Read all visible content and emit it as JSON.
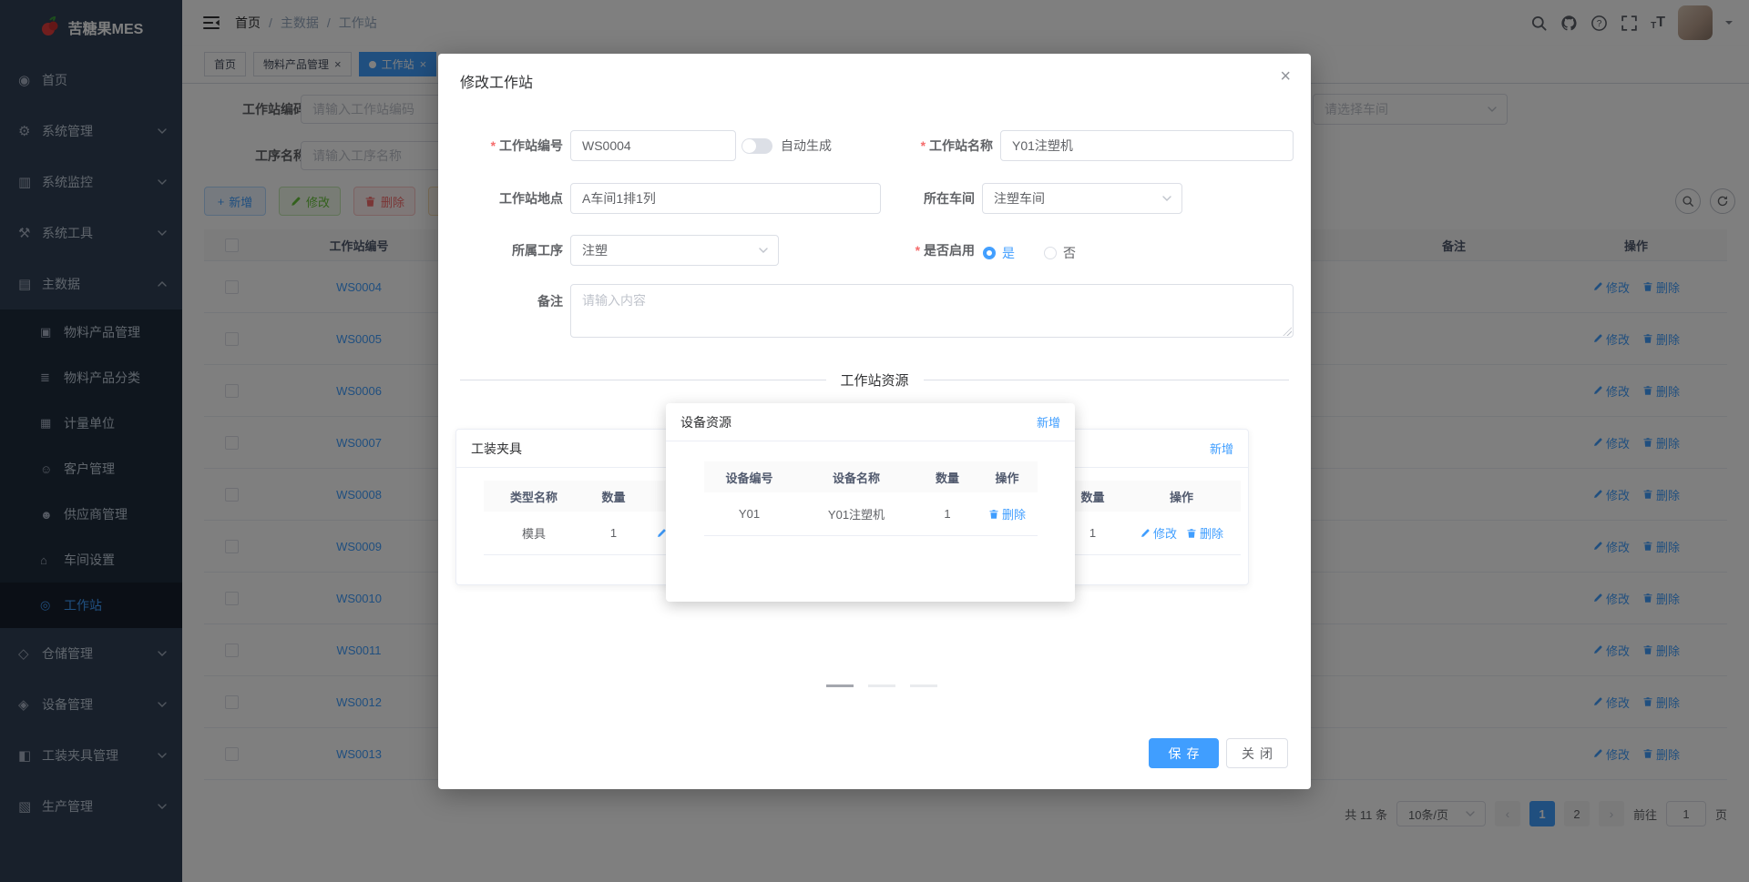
{
  "app": {
    "name": "苦糖果MES"
  },
  "icons": {
    "close": "×",
    "plus": "+",
    "breadcrumb_sep": "/"
  },
  "sidebar": {
    "menu": [
      {
        "id": "home",
        "label": "首页",
        "icon": "◉",
        "icon_name": "dashboard-icon",
        "type": "top"
      },
      {
        "id": "system-mgmt",
        "label": "系统管理",
        "icon": "⚙",
        "icon_name": "gear-icon",
        "type": "top",
        "chevron": "down"
      },
      {
        "id": "system-monitor",
        "label": "系统监控",
        "icon": "▥",
        "icon_name": "monitor-icon",
        "type": "top",
        "chevron": "down"
      },
      {
        "id": "system-tools",
        "label": "系统工具",
        "icon": "⚒",
        "icon_name": "toolbox-icon",
        "type": "top",
        "chevron": "down"
      },
      {
        "id": "master-data",
        "label": "主数据",
        "icon": "▤",
        "icon_name": "database-icon",
        "type": "top",
        "chevron": "up"
      },
      {
        "id": "material-product-mgmt",
        "label": "物料产品管理",
        "icon": "▣",
        "icon_name": "product-icon",
        "type": "sub"
      },
      {
        "id": "material-product-category",
        "label": "物料产品分类",
        "icon": "≣",
        "icon_name": "category-icon",
        "type": "sub"
      },
      {
        "id": "measure-unit",
        "label": "计量单位",
        "icon": "▦",
        "icon_name": "unit-icon",
        "type": "sub"
      },
      {
        "id": "customer-mgmt",
        "label": "客户管理",
        "icon": "☺",
        "icon_name": "customer-icon",
        "type": "sub"
      },
      {
        "id": "supplier-mgmt",
        "label": "供应商管理",
        "icon": "☻",
        "icon_name": "supplier-icon",
        "type": "sub"
      },
      {
        "id": "workshop-settings",
        "label": "车间设置",
        "icon": "⌂",
        "icon_name": "workshop-icon",
        "type": "sub"
      },
      {
        "id": "workstation",
        "label": "工作站",
        "icon": "◎",
        "icon_name": "workstation-icon",
        "type": "sub",
        "active": true
      },
      {
        "id": "warehouse-mgmt",
        "label": "仓储管理",
        "icon": "◇",
        "icon_name": "warehouse-icon",
        "type": "top",
        "chevron": "down"
      },
      {
        "id": "equipment-mgmt",
        "label": "设备管理",
        "icon": "◈",
        "icon_name": "equipment-icon",
        "type": "top",
        "chevron": "down"
      },
      {
        "id": "fixture-mgmt",
        "label": "工装夹具管理",
        "icon": "◧",
        "icon_name": "fixture-icon",
        "type": "top",
        "chevron": "down"
      },
      {
        "id": "production-mgmt",
        "label": "生产管理",
        "icon": "▧",
        "icon_name": "production-icon",
        "type": "top",
        "chevron": "down"
      }
    ]
  },
  "header": {
    "breadcrumb": [
      "首页",
      "主数据",
      "工作站"
    ]
  },
  "tags": [
    {
      "id": "home",
      "label": "首页"
    },
    {
      "id": "material-product-mgmt",
      "label": "物料产品管理",
      "closable": true
    },
    {
      "id": "workstation",
      "label": "工作站",
      "closable": true,
      "active": true
    }
  ],
  "filters": {
    "code_label": "工作站编码",
    "code_placeholder": "请输入工作站编码",
    "process_label": "工序名称",
    "process_placeholder": "请输入工序名称",
    "workshop_placeholder": "请选择车间"
  },
  "toolbar": {
    "add_label": "新增",
    "edit_label": "修改",
    "delete_label": "删除"
  },
  "table": {
    "header_code": "工作站编号",
    "header_remark": "备注",
    "header_op": "操作",
    "action_edit": "修改",
    "action_delete": "删除",
    "rows": [
      "WS0004",
      "WS0005",
      "WS0006",
      "WS0007",
      "WS0008",
      "WS0009",
      "WS0010",
      "WS0011",
      "WS0012",
      "WS0013"
    ]
  },
  "pagination": {
    "total": "共 11 条",
    "page_size": "10条/页",
    "prev": "‹",
    "next": "›",
    "pages": [
      {
        "label": "1",
        "active": true
      },
      {
        "label": "2"
      }
    ],
    "goto_label": "前往",
    "goto_value": "1",
    "page_unit": "页"
  },
  "modal": {
    "title": "修改工作站",
    "fields": {
      "code": {
        "label": "工作站编号",
        "value": "WS0004",
        "required": true
      },
      "auto_gen": {
        "label": "自动生成",
        "on": false
      },
      "name": {
        "label": "工作站名称",
        "value": "Y01注塑机",
        "required": true
      },
      "location": {
        "label": "工作站地点",
        "value": "A车间1排1列"
      },
      "workshop": {
        "label": "所在车间",
        "value": "注塑车间"
      },
      "process": {
        "label": "所属工序",
        "value": "注塑"
      },
      "enabled": {
        "label": "是否启用",
        "yes": "是",
        "no": "否",
        "selected": "yes",
        "required": true
      },
      "remark": {
        "label": "备注",
        "placeholder": "请输入内容",
        "value": ""
      }
    },
    "section_title": "工作站资源",
    "cards": {
      "fixture": {
        "title": "工装夹具",
        "add_label": "新增",
        "headers": [
          "类型名称",
          "数量",
          "操作"
        ],
        "row": {
          "type_name": "模具",
          "qty": "1"
        },
        "action_edit": "修改",
        "action_delete": "删除"
      },
      "equipment": {
        "title": "设备资源",
        "add_label": "新增",
        "headers": [
          "设备编号",
          "设备名称",
          "数量",
          "操作"
        ],
        "row": {
          "code": "Y01",
          "name": "Y01注塑机",
          "qty": "1"
        },
        "action_delete": "删除"
      },
      "third": {
        "add_label": "新增",
        "headers": [
          "数量",
          "操作"
        ],
        "row": {
          "qty": "1"
        },
        "action_edit": "修改",
        "action_delete": "删除"
      }
    },
    "footer": {
      "save": "保存",
      "close": "关闭"
    }
  },
  "colors": {
    "primary": "#409EFF",
    "success": "#67C23A",
    "danger": "#F56C6C",
    "warning": "#E6A23C",
    "sidebar_bg": "#304156",
    "sidebar_sub_bg": "#1f2d3d"
  }
}
